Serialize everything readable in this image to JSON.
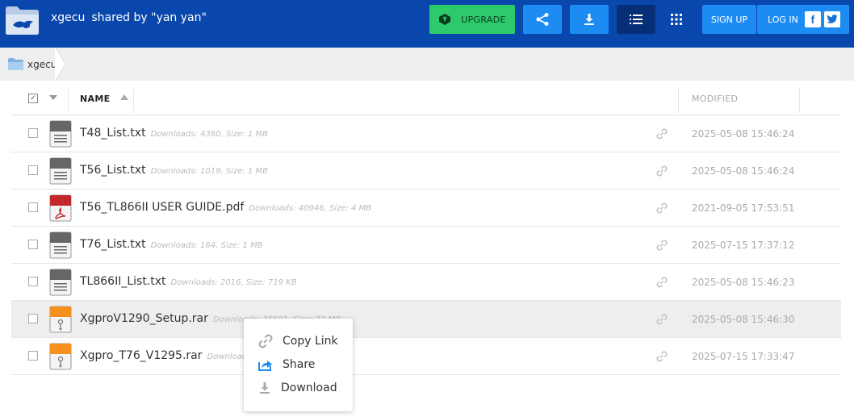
{
  "header": {
    "folder_name": "xgecu",
    "shared_by": "shared by \"yan yan\"",
    "upgrade_label": "UPGRADE",
    "signup_label": "SIGN UP",
    "login_label": "LOG IN",
    "facebook_glyph": "f",
    "colors": {
      "bar": "#0a47ad",
      "upgrade": "#2dc96b",
      "action": "#1c8cf2",
      "active": "#062f77"
    }
  },
  "breadcrumb": {
    "label": "xgecu"
  },
  "table": {
    "col_name": "NAME",
    "col_modified": "MODIFIED",
    "header_check_glyph": "✓"
  },
  "files": [
    {
      "name": "T48_List.txt",
      "meta": "Downloads: 4360, Size: 1 MB",
      "date": "2025-05-08 15:46:24",
      "icon": "txt-file-icon"
    },
    {
      "name": "T56_List.txt",
      "meta": "Downloads: 1019, Size: 1 MB",
      "date": "2025-05-08 15:46:24",
      "icon": "txt-file-icon"
    },
    {
      "name": "T56_TL866II USER GUIDE.pdf",
      "meta": "Downloads: 40946, Size: 4 MB",
      "date": "2021-09-05 17:53:51",
      "icon": "pdf-file-icon"
    },
    {
      "name": "T76_List.txt",
      "meta": "Downloads: 164, Size: 1 MB",
      "date": "2025-07-15 17:37:12",
      "icon": "txt-file-icon"
    },
    {
      "name": "TL866II_List.txt",
      "meta": "Downloads: 2016, Size: 719 KB",
      "date": "2025-05-08 15:46:23",
      "icon": "txt-file-icon"
    },
    {
      "name": "XgproV1290_Setup.rar",
      "meta": "Downloads: 25591, Size: 73 MB",
      "date": "2025-05-08 15:46:30",
      "icon": "archive-file-icon"
    },
    {
      "name": "Xgpro_T76_V1295.rar",
      "meta": "Downloads: 2140, Size: 73 MB",
      "date": "2025-07-15 17:33:47",
      "icon": "archive-file-icon"
    }
  ],
  "context_menu": {
    "items": [
      {
        "label": "Copy Link",
        "icon": "link-icon"
      },
      {
        "label": "Share",
        "icon": "share-icon"
      },
      {
        "label": "Download",
        "icon": "download-icon"
      }
    ]
  }
}
